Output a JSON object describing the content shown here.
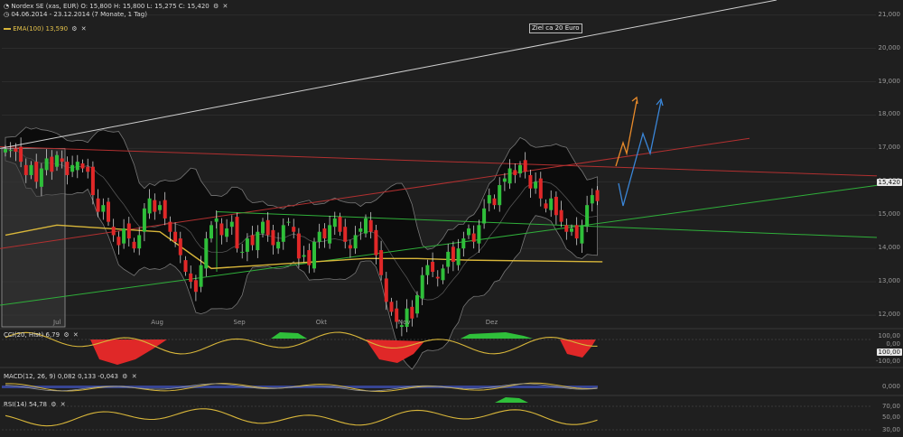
{
  "header": {
    "instrument": "Nordex SE (xas, EUR) O: 15,800 H: 15,800 L: 15,275 C: 15,420",
    "range": "04.06.2014 - 23.12.2014 (7 Monate, 1 Tag)",
    "ema_label": "EMA(100) 13,590",
    "annotation": "Ziel ca 20 Euro"
  },
  "price_axis": {
    "ticks": [
      "21,000",
      "20,000",
      "19,000",
      "18,000",
      "17,000",
      "16,000",
      "15,000",
      "14,000",
      "13,000",
      "12,000"
    ],
    "tick_values": [
      21,
      20,
      19,
      18,
      17,
      16,
      15,
      14,
      13,
      12
    ],
    "ymin": 11.65,
    "ymax": 21.45,
    "last_price": "15,420"
  },
  "time_axis": {
    "labels": [
      "Jul",
      "Aug",
      "Sep",
      "Okt",
      "Nov",
      "Dez"
    ],
    "label_index": [
      10,
      29,
      45,
      61,
      77,
      94
    ]
  },
  "colors": {
    "up": "#2fbf3a",
    "down": "#e02828",
    "band": "#0c0c0c",
    "ema": "#d8b63a",
    "osc": "#d8b63a",
    "red_line": "#b23030",
    "green_line": "#2faf3a",
    "white_line": "#cfcfcf",
    "arrow_orange": "#e88a2a",
    "arrow_blue": "#3a86d8"
  },
  "indicators": {
    "cci": {
      "label": "CCI(20, Hist) 6,79",
      "ticks": [
        "100,00",
        "0,00",
        "-100,00"
      ],
      "current": "100,00"
    },
    "macd": {
      "label": "MACD(12, 26, 9) 0,082 0,133 -0,043",
      "ticks": [
        "0,000"
      ]
    },
    "rsi": {
      "label": "RSI(14) 54,78",
      "ticks": [
        "70,00",
        "50,00",
        "30,00"
      ]
    }
  },
  "chart_data": {
    "type": "candlestick",
    "title": "Nordex SE (xas, EUR)",
    "ylim": [
      11.65,
      21.45
    ],
    "x_labels": [
      "Jul",
      "Aug",
      "Sep",
      "Okt",
      "Nov",
      "Dez"
    ],
    "close": [
      16.98,
      16.95,
      16.9,
      16.6,
      16.2,
      16.5,
      16.0,
      16.4,
      16.7,
      16.3,
      16.8,
      16.6,
      16.2,
      16.5,
      16.6,
      16.4,
      16.3,
      15.6,
      15.1,
      15.3,
      14.8,
      14.4,
      14.1,
      14.6,
      14.3,
      14.0,
      14.4,
      15.2,
      15.5,
      15.1,
      15.3,
      14.9,
      14.5,
      14.2,
      13.8,
      13.3,
      13.0,
      12.7,
      13.5,
      14.3,
      14.7,
      14.9,
      14.4,
      14.6,
      14.8,
      14.0,
      13.9,
      14.3,
      14.1,
      14.5,
      14.8,
      14.4,
      14.1,
      14.2,
      14.7,
      14.8,
      14.5,
      13.7,
      13.8,
      13.5,
      14.2,
      14.5,
      14.3,
      14.7,
      14.9,
      14.5,
      14.2,
      14.0,
      14.4,
      14.6,
      14.9,
      14.5,
      13.8,
      13.2,
      12.4,
      12.1,
      11.8,
      11.7,
      12.2,
      11.9,
      12.6,
      13.2,
      13.5,
      13.3,
      13.1,
      13.4,
      13.9,
      13.6,
      14.0,
      14.3,
      14.6,
      14.2,
      14.7,
      15.2,
      15.6,
      15.3,
      15.9,
      16.1,
      16.4,
      16.2,
      16.5,
      16.3,
      15.8,
      16.0,
      15.5,
      15.2,
      15.5,
      15.0,
      14.8,
      14.5,
      14.6,
      14.3,
      14.7,
      15.3,
      15.6,
      15.42
    ],
    "ema100": [
      14.4,
      14.7,
      14.6,
      14.5,
      13.4,
      13.5,
      13.6,
      13.7,
      13.7,
      13.65,
      13.6
    ],
    "ema100_idx": [
      0,
      10,
      20,
      30,
      40,
      50,
      60,
      70,
      80,
      90,
      116
    ]
  }
}
